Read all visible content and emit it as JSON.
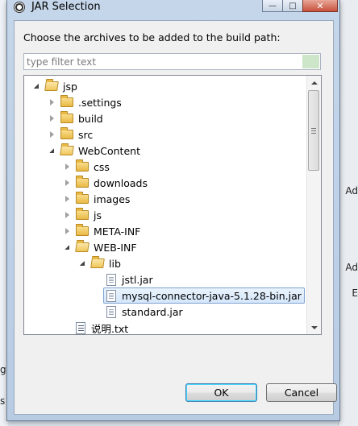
{
  "background": {
    "right_fragments": [
      "Ad",
      "Ad",
      "E"
    ],
    "left_fragments": [
      "gs",
      "s"
    ]
  },
  "window": {
    "title": "JAR Selection",
    "minimize_glyph": "—",
    "maximize_glyph": "□",
    "close_glyph": "✕"
  },
  "dialog": {
    "prompt": "Choose the archives to be added to the build path:",
    "filter": {
      "placeholder": "type filter text",
      "value": ""
    },
    "tree": [
      {
        "label": "jsp",
        "type": "folder",
        "state": "expanded",
        "depth": 0
      },
      {
        "label": ".settings",
        "type": "folder",
        "state": "collapsed",
        "depth": 1
      },
      {
        "label": "build",
        "type": "folder",
        "state": "collapsed",
        "depth": 1
      },
      {
        "label": "src",
        "type": "folder",
        "state": "collapsed",
        "depth": 1
      },
      {
        "label": "WebContent",
        "type": "folder",
        "state": "expanded",
        "depth": 1
      },
      {
        "label": "css",
        "type": "folder",
        "state": "collapsed",
        "depth": 2
      },
      {
        "label": "downloads",
        "type": "folder",
        "state": "collapsed",
        "depth": 2
      },
      {
        "label": "images",
        "type": "folder",
        "state": "collapsed",
        "depth": 2
      },
      {
        "label": "js",
        "type": "folder",
        "state": "collapsed",
        "depth": 2
      },
      {
        "label": "META-INF",
        "type": "folder",
        "state": "collapsed",
        "depth": 2
      },
      {
        "label": "WEB-INF",
        "type": "folder",
        "state": "expanded",
        "depth": 2
      },
      {
        "label": "lib",
        "type": "folder",
        "state": "expanded",
        "depth": 3
      },
      {
        "label": "jstl.jar",
        "type": "jar",
        "state": "leaf",
        "depth": 4
      },
      {
        "label": "mysql-connector-java-5.1.28-bin.jar",
        "type": "jar",
        "state": "leaf",
        "depth": 4,
        "selected": true
      },
      {
        "label": "standard.jar",
        "type": "jar",
        "state": "leaf",
        "depth": 4
      },
      {
        "label": "说明.txt",
        "type": "text-file",
        "state": "leaf",
        "depth": 2
      }
    ],
    "ok_label": "OK",
    "cancel_label": "Cancel"
  }
}
